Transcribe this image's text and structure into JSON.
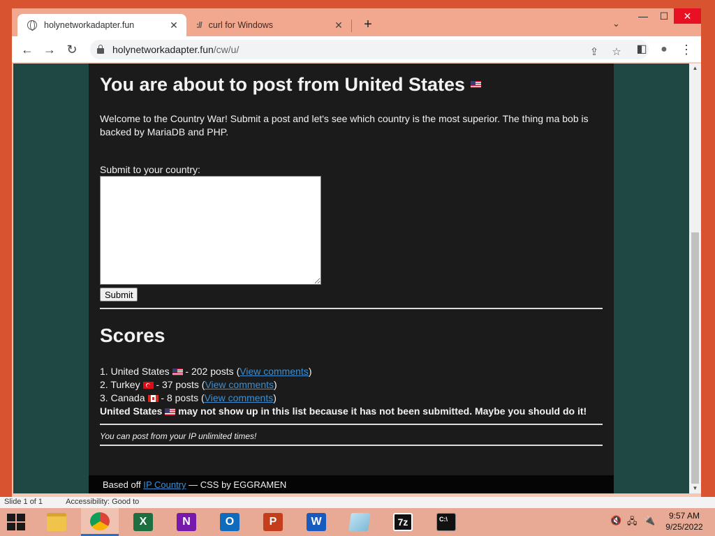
{
  "browser": {
    "tabs": [
      {
        "title": "holynetworkadapter.fun",
        "icon": "globe-icon",
        "active": true
      },
      {
        "title": "curl for Windows",
        "icon": "curl-icon",
        "active": false
      }
    ],
    "tab_close": "✕",
    "new_tab": "+",
    "tab_search": "⌄",
    "window_controls": {
      "minimize": "—",
      "maximize": "☐",
      "close": "✕"
    },
    "nav": {
      "back": "←",
      "forward": "→",
      "reload": "↻"
    },
    "address": {
      "host": "holynetworkadapter.fun",
      "path": "/cw/u/"
    },
    "omnibox_actions": {
      "share": "⇪",
      "bookmark": "☆"
    },
    "toolbar_actions": {
      "side_panel": "◧",
      "profile": "●",
      "menu": "⋮"
    }
  },
  "page": {
    "heading": "You are about to post from United States",
    "welcome": "Welcome to the Country War! Submit a post and let's see which country is the most superior. The thing ma bob is backed by MariaDB and PHP.",
    "submit_label": "Submit to your country:",
    "textarea_value": "",
    "submit_button": "Submit",
    "scores_heading": "Scores",
    "scores": [
      {
        "rank": "1.",
        "country": "United States",
        "flag": "us",
        "posts": "- 202 posts",
        "link": "View comments"
      },
      {
        "rank": "2.",
        "country": "Turkey",
        "flag": "tr",
        "posts": "- 37 posts",
        "link": "View comments"
      },
      {
        "rank": "3.",
        "country": "Canada",
        "flag": "ca",
        "posts": "- 8 posts",
        "link": "View comments"
      }
    ],
    "warning_country": "United States",
    "warning_text": "may not show up in this list because it has not been submitted. Maybe you should do it!",
    "note": "You can post from your IP unlimited times!",
    "footer": {
      "prefix": "Based off",
      "link": "IP Country",
      "suffix": "— CSS by EGGRAMEN"
    }
  },
  "background_app": {
    "status": "Slide 1 of 1",
    "accessibility": "Accessibility: Good to"
  },
  "taskbar": {
    "apps": [
      {
        "name": "file-explorer",
        "label": ""
      },
      {
        "name": "chrome",
        "label": ""
      },
      {
        "name": "excel",
        "label": "X"
      },
      {
        "name": "onenote",
        "label": "N"
      },
      {
        "name": "outlook",
        "label": "O"
      },
      {
        "name": "powerpoint",
        "label": "P"
      },
      {
        "name": "word",
        "label": "W"
      },
      {
        "name": "notepad",
        "label": ""
      },
      {
        "name": "7zip",
        "label": "7z"
      },
      {
        "name": "cmd",
        "label": "C:\\"
      }
    ],
    "time": "9:57 AM",
    "date": "9/25/2022"
  },
  "colors": {
    "window_frame": "#d8532f",
    "tabstrip": "#f2a88e",
    "page_bg": "#1f4744",
    "content_bg": "#1b1b1b",
    "link": "#3b8fd4",
    "taskbar": "#e8aa94"
  }
}
